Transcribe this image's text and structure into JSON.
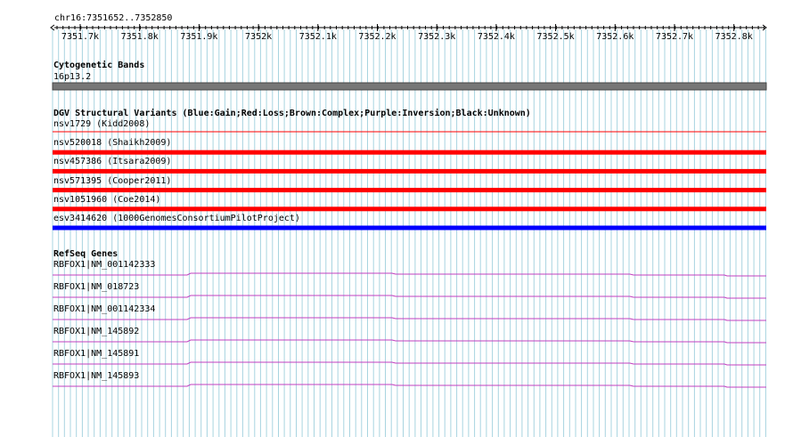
{
  "region": {
    "label": "chr16:7351652..7352850"
  },
  "ruler": {
    "ticks": [
      "7351.7k",
      "7351.8k",
      "7351.9k",
      "7352k",
      "7352.1k",
      "7352.2k",
      "7352.3k",
      "7352.4k",
      "7352.5k",
      "7352.6k",
      "7352.7k",
      "7352.8k"
    ]
  },
  "colors": {
    "grid": "#a8d4e0",
    "cytoband_fill": "#777777",
    "gain": "#0000ff",
    "loss": "#ff0000",
    "gene": "#c040c0",
    "axis": "#000000"
  },
  "tracks": {
    "cytobands": {
      "title": "Cytogenetic Bands",
      "band_label": "16p13.2"
    },
    "dgv": {
      "title": "DGV Structural Variants (Blue:Gain;Red:Loss;Brown:Complex;Purple:Inversion;Black:Unknown)",
      "variants": [
        {
          "label": "nsv1729 (Kidd2008)",
          "type": "loss",
          "style": "thin"
        },
        {
          "label": "nsv520018 (Shaikh2009)",
          "type": "loss",
          "style": "thick"
        },
        {
          "label": "nsv457386 (Itsara2009)",
          "type": "loss",
          "style": "thick"
        },
        {
          "label": "nsv571395 (Cooper2011)",
          "type": "loss",
          "style": "thick"
        },
        {
          "label": "nsv1051960 (Coe2014)",
          "type": "loss",
          "style": "thick"
        },
        {
          "label": "esv3414620 (1000GenomesConsortiumPilotProject)",
          "type": "gain",
          "style": "thick"
        }
      ]
    },
    "refseq": {
      "title": "RefSeq Genes",
      "genes": [
        {
          "label": "RBFOX1|NM_001142333"
        },
        {
          "label": "RBFOX1|NM_018723"
        },
        {
          "label": "RBFOX1|NM_001142334"
        },
        {
          "label": "RBFOX1|NM_145892"
        },
        {
          "label": "RBFOX1|NM_145891"
        },
        {
          "label": "RBFOX1|NM_145893"
        }
      ]
    }
  }
}
